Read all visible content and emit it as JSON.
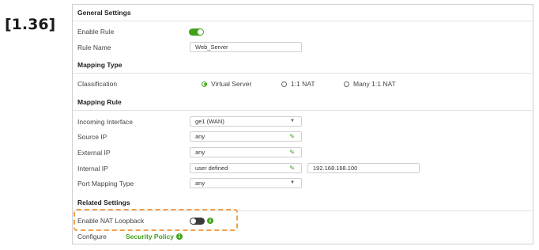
{
  "step_label": "[1.36]",
  "general": {
    "title": "General Settings",
    "enable_rule_label": "Enable Rule",
    "enable_rule_on": true,
    "rule_name_label": "Rule Name",
    "rule_name_value": "Web_Server"
  },
  "mapping_type": {
    "title": "Mapping Type",
    "classification_label": "Classification",
    "options": [
      "Virtual Server",
      "1:1 NAT",
      "Many 1:1 NAT"
    ],
    "selected": "Virtual Server"
  },
  "mapping_rule": {
    "title": "Mapping Rule",
    "incoming_interface_label": "Incoming Interface",
    "incoming_interface_value": "ge1 (WAN)",
    "source_ip_label": "Source IP",
    "source_ip_value": "any",
    "external_ip_label": "External IP",
    "external_ip_value": "any",
    "internal_ip_label": "Internal IP",
    "internal_ip_value": "user defined",
    "internal_ip_address": "192.168.168.100",
    "port_mapping_label": "Port Mapping Type",
    "port_mapping_value": "any"
  },
  "related": {
    "title": "Related Settings",
    "nat_loopback_label": "Enable NAT Loopback",
    "nat_loopback_on": false,
    "configure_label": "Configure",
    "security_policy_link": "Security Policy"
  },
  "icons": {
    "pencil": "✎",
    "chevron": "▼",
    "info": "i"
  },
  "colors": {
    "accent": "#3fa31a",
    "highlight": "#f0a04b"
  }
}
